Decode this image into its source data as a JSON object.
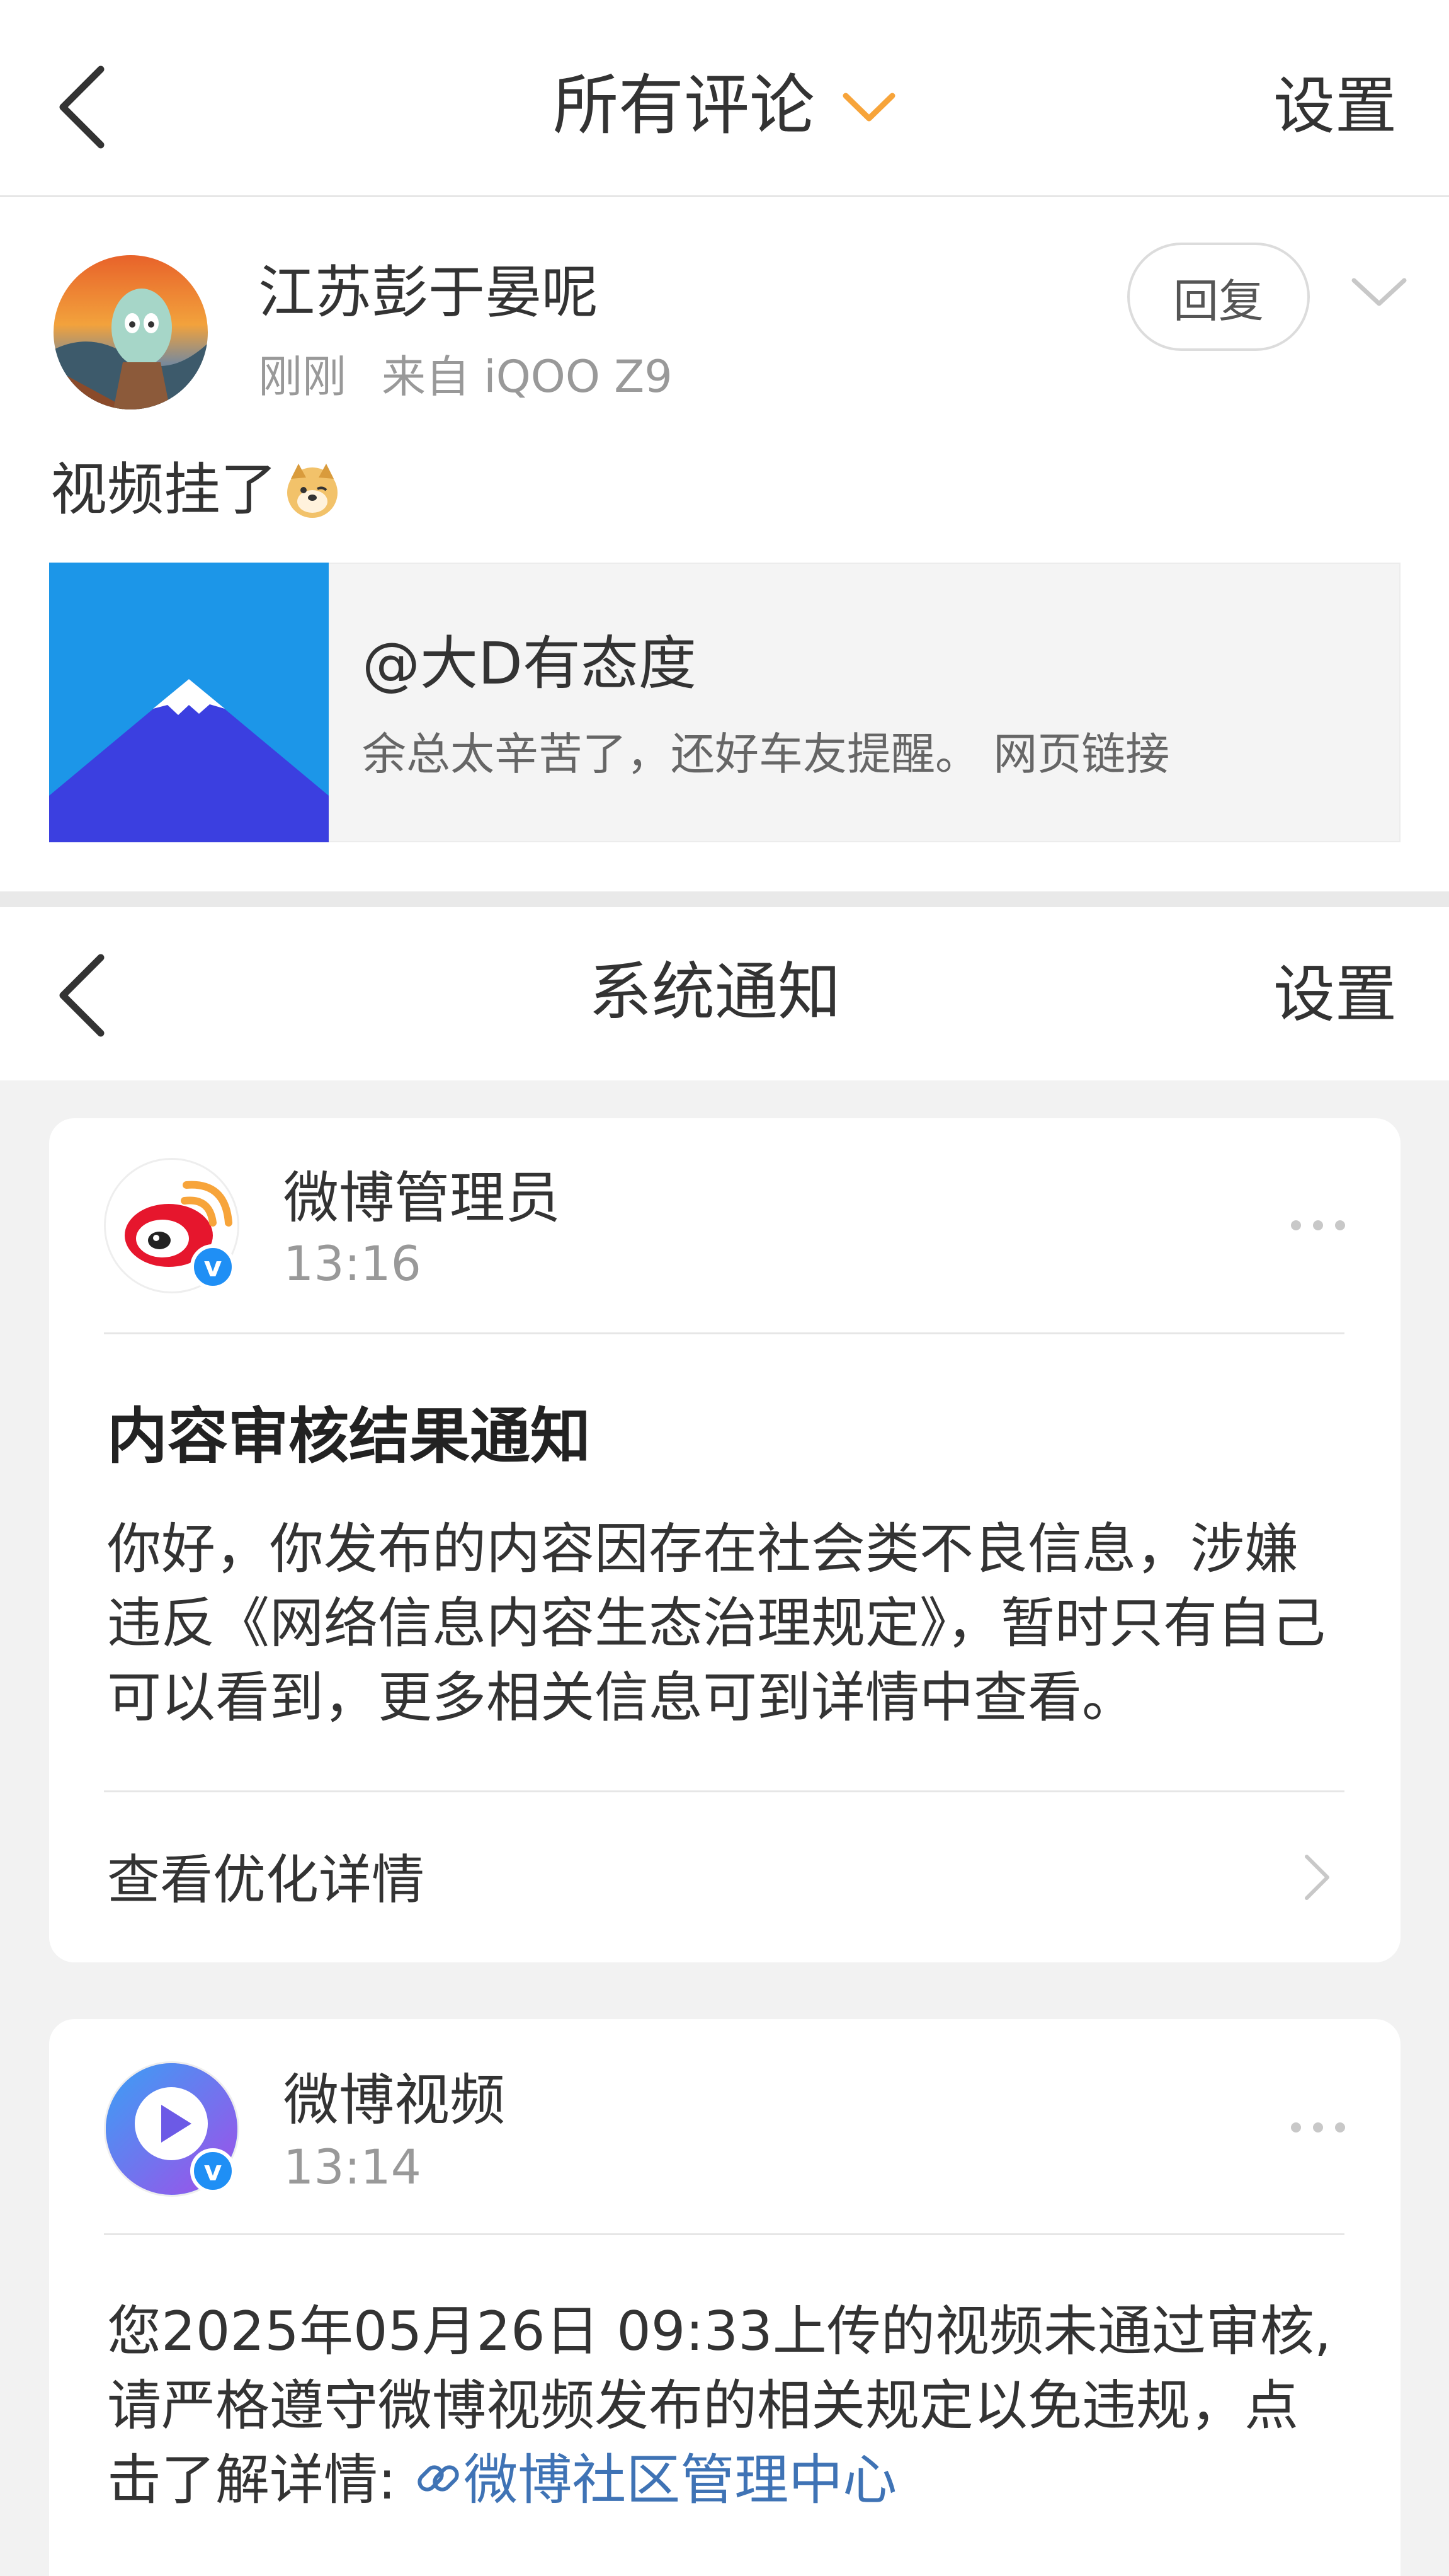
{
  "comments_header": {
    "title": "所有评论",
    "settings_label": "设置"
  },
  "comment": {
    "user_name": "江苏彭于晏呢",
    "time": "刚刚",
    "source": "来自 iQOO Z9",
    "reply_label": "回复",
    "text": "视频挂了",
    "emoji": "doge-emoji",
    "attachment": {
      "title": "@大D有态度",
      "description": "余总太辛苦了，还好车友提醒。 网页链接"
    }
  },
  "notifications_header": {
    "title": "系统通知",
    "settings_label": "设置"
  },
  "notifications": [
    {
      "sender": "微博管理员",
      "time": "13:16",
      "heading": "内容审核结果通知",
      "body": "你好，你发布的内容因存在社会类不良信息，涉嫌违反《网络信息内容生态治理规定》，暂时只有自己可以看到，更多相关信息可到详情中查看。",
      "action_label": "查看优化详情"
    },
    {
      "sender": "微博视频",
      "time": "13:14",
      "body": "您2025年05月26日 09:33上传的视频未通过审核,请严格遵守微博视频发布的相关规定以免违规，点击了解详情: ",
      "link_text": "微博社区管理中心"
    }
  ],
  "colors": {
    "accent_orange": "#f7a43a",
    "link_blue": "#3f73b5",
    "verify_blue": "#1f8ff5"
  }
}
